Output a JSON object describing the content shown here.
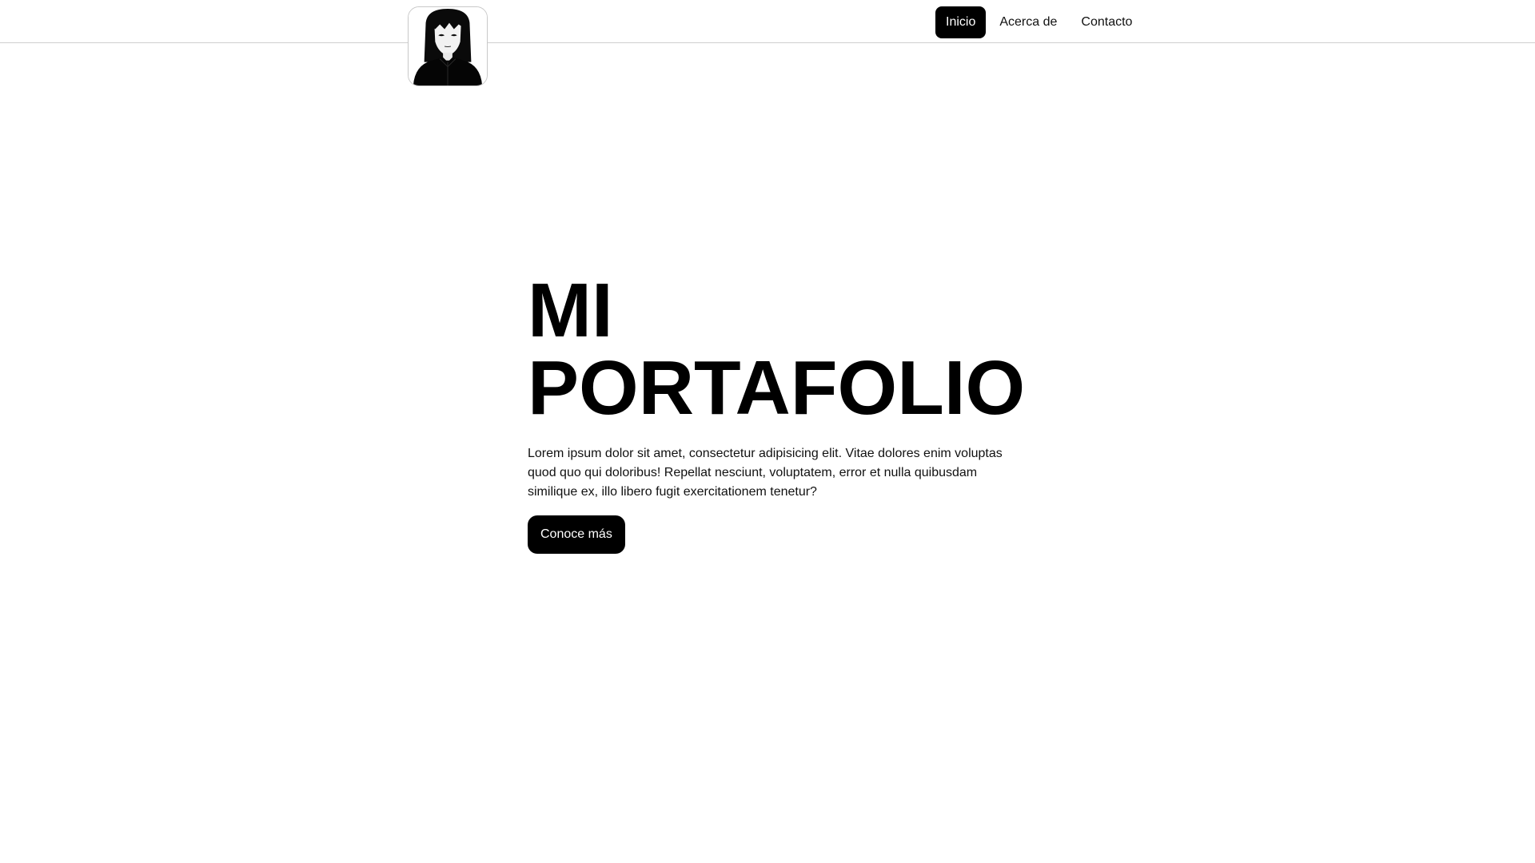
{
  "nav": {
    "logo_icon": "anime-portrait-avatar",
    "links": [
      {
        "label": "Inicio",
        "active": true
      },
      {
        "label": "Acerca de",
        "active": false
      },
      {
        "label": "Contacto",
        "active": false
      }
    ]
  },
  "hero": {
    "title_line1": "MI",
    "title_line2": "PORTAFOLIO",
    "description": "Lorem ipsum dolor sit amet, consectetur adipisicing elit. Vitae dolores enim voluptas quod quo qui doloribus! Repellat nesciunt, voluptatem, error et nulla quibusdam similique ex, illo libero fugit exercitationem tenetur?",
    "cta_label": "Conoce más"
  },
  "colors": {
    "background": "#ffffff",
    "accent": "#000000",
    "divider": "#cfcfcf"
  }
}
